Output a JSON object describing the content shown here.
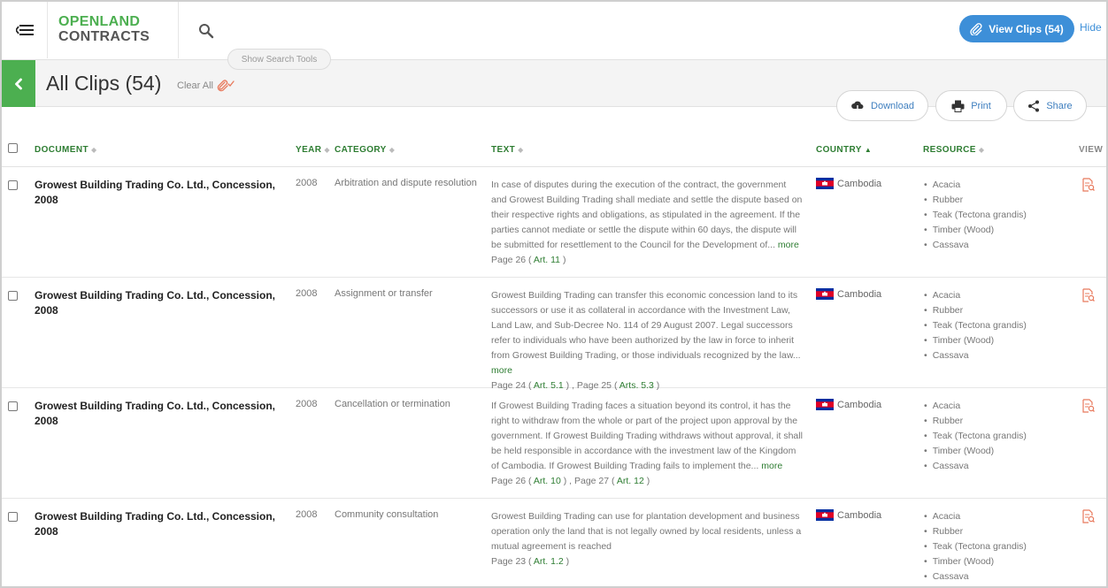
{
  "header": {
    "menu_icon": "menu-collapse-icon",
    "logo_line1": "OPENLAND",
    "logo_line2": "CONTRACTS",
    "search_icon": "search-icon",
    "search_tools_label": "Show Search Tools",
    "view_clips_label": "View Clips (54)",
    "hide_label": "Hide",
    "accent_color": "#4caf50",
    "button_color": "#3d8fd8"
  },
  "titlebar": {
    "title": "All Clips (54)",
    "clear_all_label": "Clear All",
    "download_label": "Download",
    "print_label": "Print",
    "share_label": "Share"
  },
  "table": {
    "columns": {
      "document": "DOCUMENT",
      "year": "YEAR",
      "category": "CATEGORY",
      "text": "TEXT",
      "country": "COUNTRY",
      "resource": "RESOURCE",
      "view": "VIEW"
    },
    "sorted_column": "country",
    "rows": [
      {
        "document": "Growest Building Trading Co. Ltd., Concession, 2008",
        "year": "2008",
        "category": "Arbitration and dispute resolution",
        "text": "In case of disputes during the execution of the contract, the government and Growest Building Trading shall mediate and settle the dispute based on their respective rights and obligations, as stipulated in the agreement. If the parties cannot mediate or settle the dispute within 60 days, the dispute will be submitted for resettlement to the Council for the Development of...",
        "more": "more",
        "pages": [
          {
            "prefix": "Page 26 ( ",
            "art": "Art. 11",
            "suffix": " )"
          }
        ],
        "country": "Cambodia",
        "resources": [
          "Acacia",
          "Rubber",
          "Teak (Tectona grandis)",
          "Timber (Wood)",
          "Cassava"
        ]
      },
      {
        "document": "Growest Building Trading Co. Ltd., Concession, 2008",
        "year": "2008",
        "category": "Assignment or transfer",
        "text": "Growest Building Trading can transfer this economic concession land to its successors or use it as collateral in accordance with the Investment Law, Land Law, and Sub-Decree No. 114 of 29 August 2007. Legal successors refer to individuals who have been authorized by the law in force to inherit from Growest Building Trading, or those individuals recognized by the law...",
        "more": "more",
        "pages": [
          {
            "prefix": "Page 24 ( ",
            "art": "Art. 5.1",
            "suffix": " ) , "
          },
          {
            "prefix": "Page 25 ( ",
            "art": "Arts. 5.3",
            "suffix": " )"
          }
        ],
        "country": "Cambodia",
        "resources": [
          "Acacia",
          "Rubber",
          "Teak (Tectona grandis)",
          "Timber (Wood)",
          "Cassava"
        ]
      },
      {
        "document": "Growest Building Trading Co. Ltd., Concession, 2008",
        "year": "2008",
        "category": "Cancellation or termination",
        "text": "If Growest Building Trading faces a situation beyond its control, it has the right to withdraw from the whole or part of the project upon approval by the government. If Growest Building Trading withdraws without approval, it shall be held responsible in accordance with the investment law of the Kingdom of Cambodia. If Growest Building Trading fails to implement the...",
        "more": "more",
        "pages": [
          {
            "prefix": "Page 26 ( ",
            "art": "Art. 10",
            "suffix": " ) , "
          },
          {
            "prefix": "Page 27 ( ",
            "art": "Art. 12",
            "suffix": " )"
          }
        ],
        "country": "Cambodia",
        "resources": [
          "Acacia",
          "Rubber",
          "Teak (Tectona grandis)",
          "Timber (Wood)",
          "Cassava"
        ]
      },
      {
        "document": "Growest Building Trading Co. Ltd., Concession, 2008",
        "year": "2008",
        "category": "Community consultation",
        "text": "Growest Building Trading can use for plantation development and business operation only the land that is not legally owned by local residents, unless a mutual agreement is reached",
        "more": "",
        "pages": [
          {
            "prefix": "Page 23 ( ",
            "art": "Art. 1.2",
            "suffix": " )"
          }
        ],
        "country": "Cambodia",
        "resources": [
          "Acacia",
          "Rubber",
          "Teak (Tectona grandis)",
          "Timber (Wood)",
          "Cassava"
        ]
      }
    ]
  }
}
